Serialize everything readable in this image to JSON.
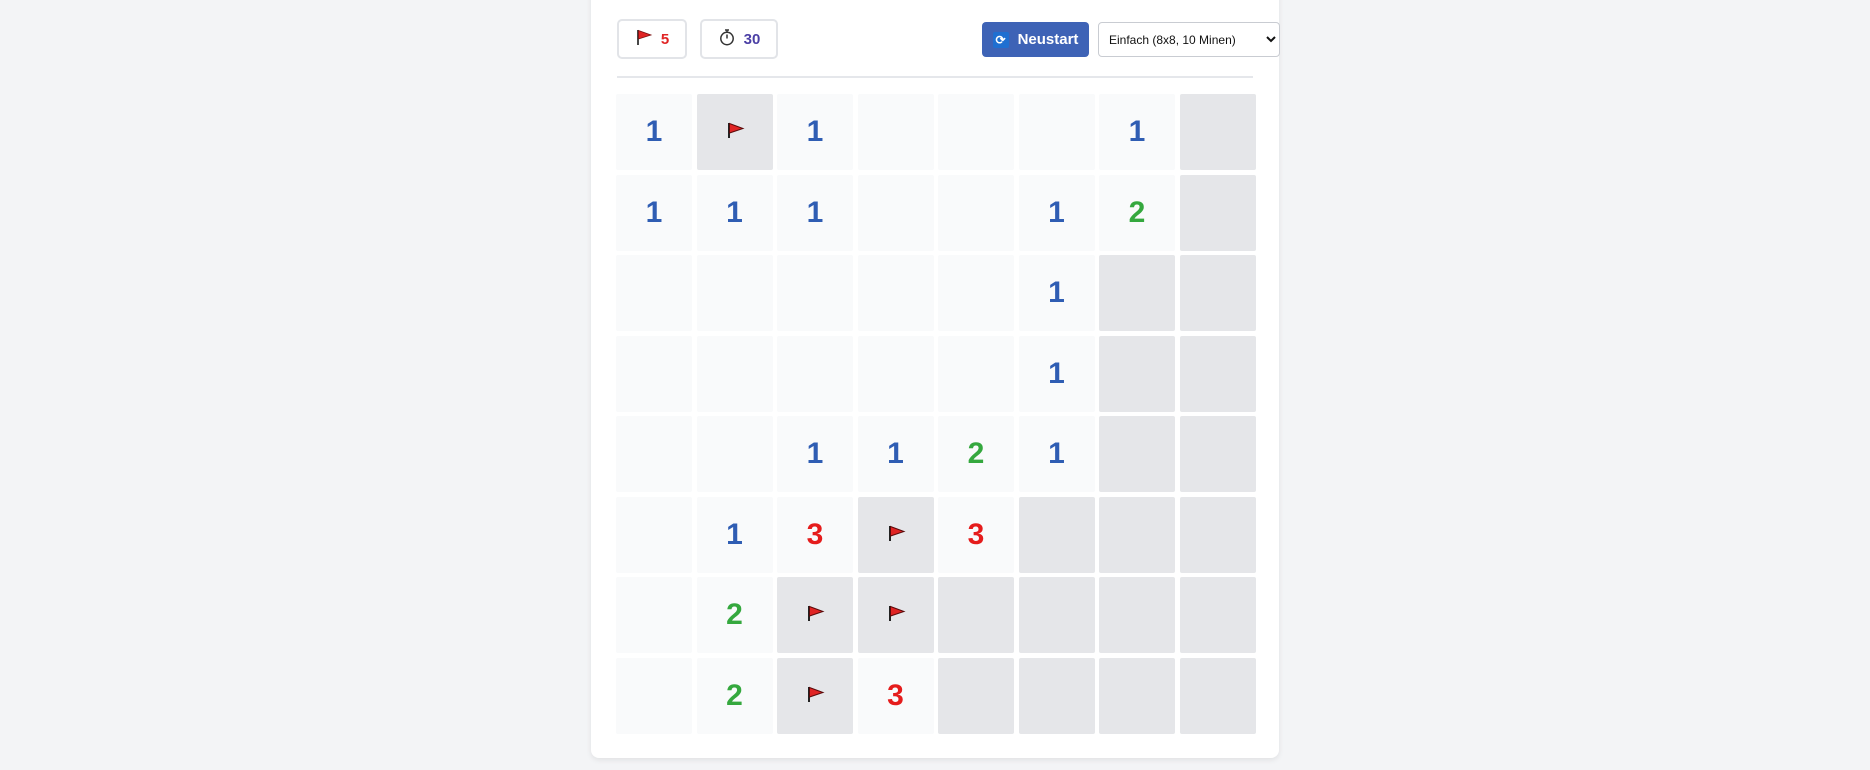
{
  "header": {
    "flag_count": "5",
    "time": "30",
    "restart_label": "Neustart",
    "difficulty_selected": "Einfach (8x8, 10 Minen)"
  },
  "icons": {
    "flag": "flag-icon",
    "timer": "stopwatch-icon",
    "restart": "refresh-icon"
  },
  "colors": {
    "number_1": "#2f5db3",
    "number_2": "#35a83e",
    "number_3": "#e51c1c",
    "restart_button": "#3e63b6",
    "flag": "#e02424"
  },
  "board": {
    "rows": 8,
    "cols": 8,
    "legend": "R = revealed empty, H = hidden, F = flagged, digit = revealed number",
    "cells": [
      [
        "1",
        "F",
        "1",
        "R",
        "R",
        "R",
        "1",
        "H"
      ],
      [
        "1",
        "1",
        "1",
        "R",
        "R",
        "1",
        "2",
        "H"
      ],
      [
        "R",
        "R",
        "R",
        "R",
        "R",
        "1",
        "H",
        "H"
      ],
      [
        "R",
        "R",
        "R",
        "R",
        "R",
        "1",
        "H",
        "H"
      ],
      [
        "R",
        "R",
        "1",
        "1",
        "2",
        "1",
        "H",
        "H"
      ],
      [
        "R",
        "1",
        "3",
        "F",
        "3",
        "H",
        "H",
        "H"
      ],
      [
        "R",
        "2",
        "F",
        "F",
        "H",
        "H",
        "H",
        "H"
      ],
      [
        "R",
        "2",
        "F",
        "3",
        "H",
        "H",
        "H",
        "H"
      ]
    ]
  }
}
